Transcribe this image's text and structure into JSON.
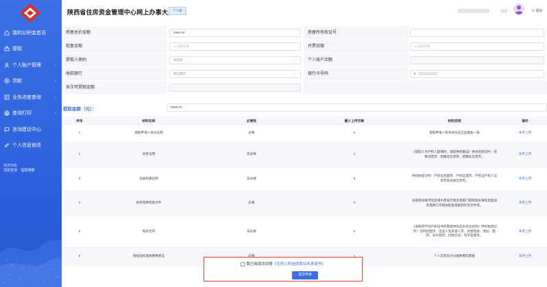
{
  "app": {
    "title": "陕西省住房资金管理中心网上办事大厅",
    "tag": "个人版",
    "logout": "退出"
  },
  "sidebar": {
    "items": [
      {
        "label": "我的公积金首页",
        "icon": "home-icon",
        "arrow": ""
      },
      {
        "label": "提取",
        "icon": "withdraw-icon",
        "arrow": ""
      },
      {
        "label": "个人账户管理",
        "icon": "user-icon",
        "arrow": "⌄"
      },
      {
        "label": "贷款",
        "icon": "loan-icon",
        "arrow": "⌄"
      },
      {
        "label": "业务进度查询",
        "icon": "progress-icon",
        "arrow": "⌄"
      },
      {
        "label": "查询打印",
        "icon": "print-icon",
        "arrow": "⌄"
      },
      {
        "label": "咨询建议中心",
        "icon": "chat-icon",
        "arrow": ""
      },
      {
        "label": "个人信息修改",
        "icon": "edit-icon",
        "arrow": ""
      }
    ],
    "common_title": "常用功能",
    "common_links": [
      "贷款查询",
      "提取明细"
    ]
  },
  "form": {
    "rows": [
      {
        "l_label": "房屋总价金额",
        "l_value": "9999.00",
        "l_type": "text",
        "r_label": "房屋所有权证号",
        "r_value": "",
        "r_type": "text"
      },
      {
        "l_label": "批复日期",
        "l_value": "选择日期",
        "l_type": "date",
        "r_label": "开票日期",
        "r_value": "选择日期",
        "r_type": "date"
      },
      {
        "l_label": "提取人类别",
        "l_value": "请选择",
        "l_type": "select",
        "r_label": "个人账户余额",
        "r_value": "",
        "r_type": "disabled"
      },
      {
        "l_label": "收款银行",
        "l_value": "建设银行",
        "l_type": "select",
        "r_label": "银行卡号码",
        "r_value": "6",
        "r_type": "text"
      },
      {
        "l_label": "本次可提取金额",
        "l_value": "",
        "l_type": "disabled",
        "r_label": "",
        "r_value": "",
        "r_type": "none"
      }
    ],
    "amount_label": "提取金额（元）：",
    "amount_value": "9999.00"
  },
  "table": {
    "headers": [
      "序号",
      "材料名称",
      "必要性",
      "最少上传页数",
      "材料说明",
      "操作"
    ],
    "rows": [
      {
        "no": "1",
        "name": "提取申请人身份证明",
        "need": "必要",
        "pages": "2",
        "desc": "提取申请人有效身份证正反面各一张",
        "action": "未传上传"
      },
      {
        "no": "2",
        "name": "关系证明",
        "need": "非必要",
        "pages": "2",
        "desc": "《提取人为产权人配偶时，请提供结婚证》供初始登记时：结婚证首页、结婚证信息页、结婚证信息页。",
        "action": "未传上传"
      },
      {
        "no": "3",
        "name": "房屋权属证明",
        "need": "非必要",
        "pages": "3",
        "desc": "供初始登记时：产权证封面页、产权证首页、产权证产权人信息页及房屋信息页。",
        "action": "未传上传"
      },
      {
        "no": "4",
        "name": "加装电梯批复文件",
        "need": "必要",
        "pages": "2",
        "desc": "县级或县级市住房城乡建设行政主管部门或街道办事处批复加装电梯工作相关批复或规划许可文件等。",
        "action": "未传上传"
      },
      {
        "no": "5",
        "name": "购房合同",
        "need": "非必要",
        "pages": "5",
        "desc": "《未取得不动产权证书的需提供商品房买卖合同》供初始登记时：合同封面页、出卖人及买受人页、房屋性质、地址、面积、总价款页、付款方式、签字盖章页。",
        "action": "未传上传"
      },
      {
        "no": "6",
        "name": "增加加装电梯费用发证",
        "need": "必要",
        "pages": "1",
        "desc": "个人实际支付分摊费用的票据",
        "action": "未传上传"
      }
    ]
  },
  "confirm": {
    "prefix": "我已阅读并同意",
    "link": "《住房公积金提取业务承诺书》",
    "submit": "提交申请"
  }
}
